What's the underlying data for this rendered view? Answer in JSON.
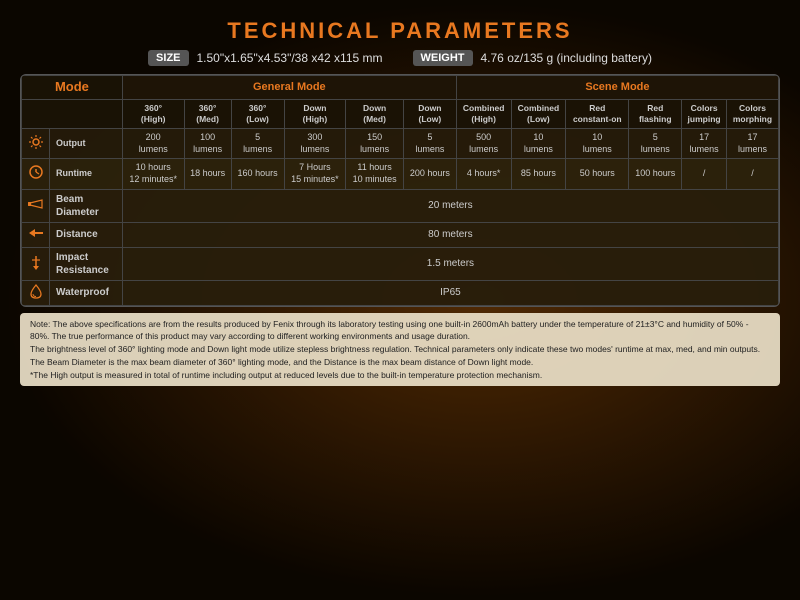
{
  "title": "TECHNICAL PARAMETERS",
  "size_label": "SIZE",
  "size_value": "1.50\"x1.65\"x4.53\"/38 x42 x115 mm",
  "weight_label": "WEIGHT",
  "weight_value": "4.76 oz/135 g (including battery)",
  "table": {
    "header_general": "General Mode",
    "header_scene": "Scene Mode",
    "col_headers": [
      "360°\n(High)",
      "360°\n(Med)",
      "360°\n(Low)",
      "Down\n(High)",
      "Down\n(Med)",
      "Down\n(Low)",
      "Combined\n(High)",
      "Combined\n(Low)",
      "Red\nconstant-on",
      "Red\nflashing",
      "Colors\njumping",
      "Colors\nmorphing"
    ],
    "rows": [
      {
        "icon": "sun",
        "label": "Output",
        "values": [
          "200\nlumens",
          "100\nlumens",
          "5\nlumens",
          "300\nlumens",
          "150\nlumens",
          "5\nlumens",
          "500\nlumens",
          "10\nlumens",
          "10\nlumens",
          "5\nlumens",
          "17\nlumens",
          "17\nlumens"
        ]
      },
      {
        "icon": "clock",
        "label": "Runtime",
        "values": [
          "10 hours\n12 minutes*",
          "18 hours",
          "160 hours",
          "7 Hours\n15 minutes*",
          "11 hours\n10 minutes",
          "200 hours",
          "4 hours*",
          "85 hours",
          "50 hours",
          "100 hours",
          "/",
          "/"
        ]
      }
    ],
    "span_rows": [
      {
        "icon": "beam",
        "label": "Beam\nDiameter",
        "value": "20 meters"
      },
      {
        "icon": "arrow",
        "label": "Distance",
        "value": "80 meters"
      },
      {
        "icon": "drop",
        "label": "Impact\nResistance",
        "value": "1.5 meters"
      },
      {
        "icon": "water",
        "label": "Waterproof",
        "value": "IP65"
      }
    ]
  },
  "notes": [
    "Note: The above specifications are from the results produced by Fenix through its laboratory testing using one built-in 2600mAh battery under the temperature of 21±3°C and humidity of 50% - 80%. The true performance of this product may vary according to different working environments and usage duration.",
    "The brightness level of 360° lighting mode and Down light mode utilize stepless brightness regulation. Technical parameters only indicate these two modes' runtime at max, med, and min outputs.",
    "The Beam Diameter is the max beam diameter of 360° lighting mode, and the Distance is the max beam distance of Down light mode.",
    "*The High output is measured in total of runtime including output at reduced levels due to the built-in temperature protection mechanism."
  ]
}
